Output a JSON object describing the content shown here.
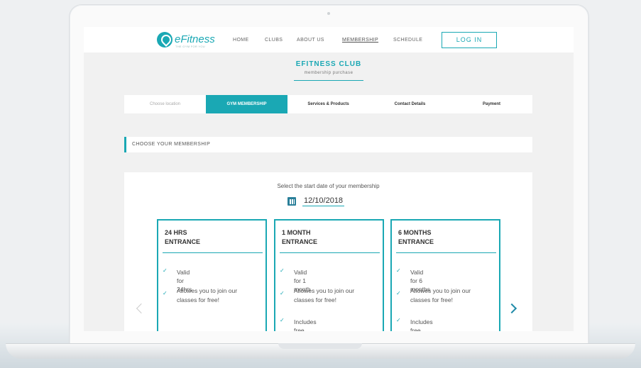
{
  "nav": {
    "logo_text": "eFitness",
    "logo_sub": "THE GYM FOR YOU",
    "links": [
      "HOME",
      "CLUBS",
      "ABOUT US",
      "MEMBERSHIP",
      "SCHEDULE"
    ],
    "login_label": "LOG IN"
  },
  "header": {
    "title": "EFITNESS CLUB",
    "subtitle": "membership purchase"
  },
  "steps": [
    "Choose location",
    "GYM MEMBERSHIP",
    "Services & Products",
    "Contact Details",
    "Payment"
  ],
  "section": {
    "title": "CHOOSE YOUR MEMBERSHIP"
  },
  "start_date": {
    "label": "Select the start date of your membership",
    "value": "12/10/2018"
  },
  "cards": [
    {
      "line1": "24 HRS",
      "line2": "ENTRANCE",
      "features": [
        "Valid for 24hrs",
        "Allowes you to join our",
        "classes for free!"
      ]
    },
    {
      "line1": "1 MONTH",
      "line2": "ENTRANCE",
      "features": [
        "Valid for 1 month",
        "Allowes you to join our",
        "classes for free!",
        "Includes free sauna"
      ]
    },
    {
      "line1": "6 MONTHS",
      "line2": "ENTRANCE",
      "features": [
        "Valid for 6 months",
        "Allowes you to join our",
        "classes for free!",
        "Includes free sauna"
      ]
    }
  ],
  "colors": {
    "accent": "#1aa8b4",
    "arrow": "#1f8aa8"
  }
}
